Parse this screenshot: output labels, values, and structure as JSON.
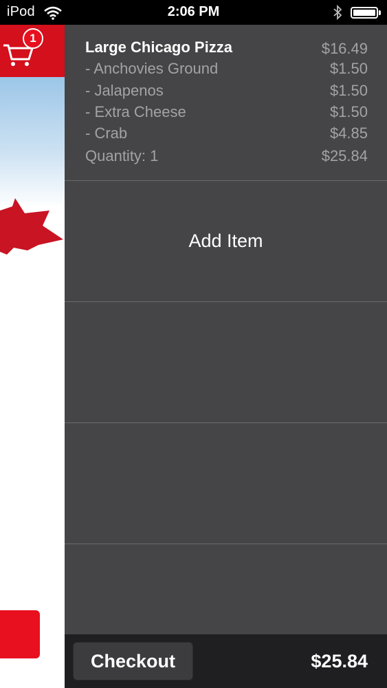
{
  "status_bar": {
    "carrier": "iPod",
    "time": "2:06 PM"
  },
  "cart_badge": {
    "count": "1"
  },
  "cart_item": {
    "name": "Large Chicago Pizza",
    "price": "$16.49",
    "modifiers": [
      {
        "label": "- Anchovies Ground",
        "price": "$1.50"
      },
      {
        "label": "- Jalapenos",
        "price": "$1.50"
      },
      {
        "label": "- Extra Cheese",
        "price": "$1.50"
      },
      {
        "label": "- Crab",
        "price": "$4.85"
      }
    ],
    "quantity_label": "Quantity: 1",
    "line_total": "$25.84"
  },
  "add_item_label": "Add Item",
  "checkout": {
    "button_label": "Checkout",
    "total": "$25.84"
  },
  "colors": {
    "brand_red": "#d3101c",
    "panel_bg": "#454446",
    "checkout_bar_bg": "#1f1f21",
    "secondary_text": "#a3a2a5"
  }
}
